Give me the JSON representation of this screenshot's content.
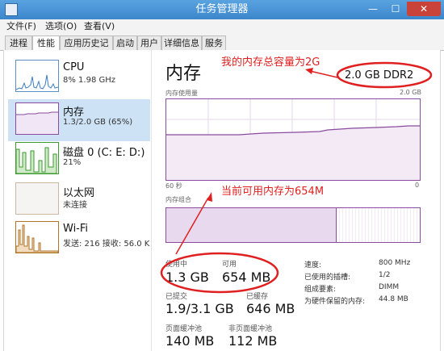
{
  "window": {
    "title": "任务管理器",
    "min_glyph": "—",
    "max_glyph": "☐",
    "close_glyph": "✕"
  },
  "menu": [
    {
      "label": "文件(F)"
    },
    {
      "label": "选项(O)"
    },
    {
      "label": "查看(V)"
    }
  ],
  "tabs": [
    {
      "label": "进程"
    },
    {
      "label": "性能",
      "active": true
    },
    {
      "label": "应用历史记录"
    },
    {
      "label": "启动"
    },
    {
      "label": "用户"
    },
    {
      "label": "详细信息"
    },
    {
      "label": "服务"
    }
  ],
  "sidebar": [
    {
      "title": "CPU",
      "sub": "8%  1.98 GHz"
    },
    {
      "title": "内存",
      "sub": "1.3/2.0 GB (65%)"
    },
    {
      "title": "磁盘 0 (C: E: D:)",
      "sub": "21%"
    },
    {
      "title": "以太网",
      "sub": "未连接"
    },
    {
      "title": "Wi-Fi",
      "sub": "发送: 216  接收: 56.0 K"
    }
  ],
  "memory": {
    "title": "内存",
    "capacity": "2.0 GB DDR2",
    "usage_label": "内存使用量",
    "usage_max": "2.0 GB",
    "time_left": "60 秒",
    "time_right": "0",
    "composition_label": "内存组合",
    "stats": {
      "in_use_label": "使用中",
      "in_use": "1.3 GB",
      "available_label": "可用",
      "available": "654 MB",
      "committed_label": "已提交",
      "committed": "1.9/3.1 GB",
      "cached_label": "已缓存",
      "cached": "646 MB",
      "paged_pool_label": "页面缓冲池",
      "paged_pool": "140 MB",
      "nonpaged_pool_label": "非页面缓冲池",
      "nonpaged_pool": "112 MB"
    },
    "details": [
      {
        "key": "速度:",
        "value": "800 MHz"
      },
      {
        "key": "已使用的插槽:",
        "value": "1/2"
      },
      {
        "key": "组成要素:",
        "value": "DIMM"
      },
      {
        "key": "为硬件保留的内存:",
        "value": "44.8 MB"
      }
    ]
  },
  "annotations": {
    "capacity_note": "我的内存总容量为2G",
    "available_note": "当前可用内存为654M"
  },
  "colors": {
    "memory_accent": "#8a4a9e",
    "cpu_accent": "#3b7dc4",
    "disk_accent": "#3c9a2f",
    "wifi_accent": "#b07426",
    "annotation_red": "#e02020",
    "title_bar": "#4a95d8"
  }
}
